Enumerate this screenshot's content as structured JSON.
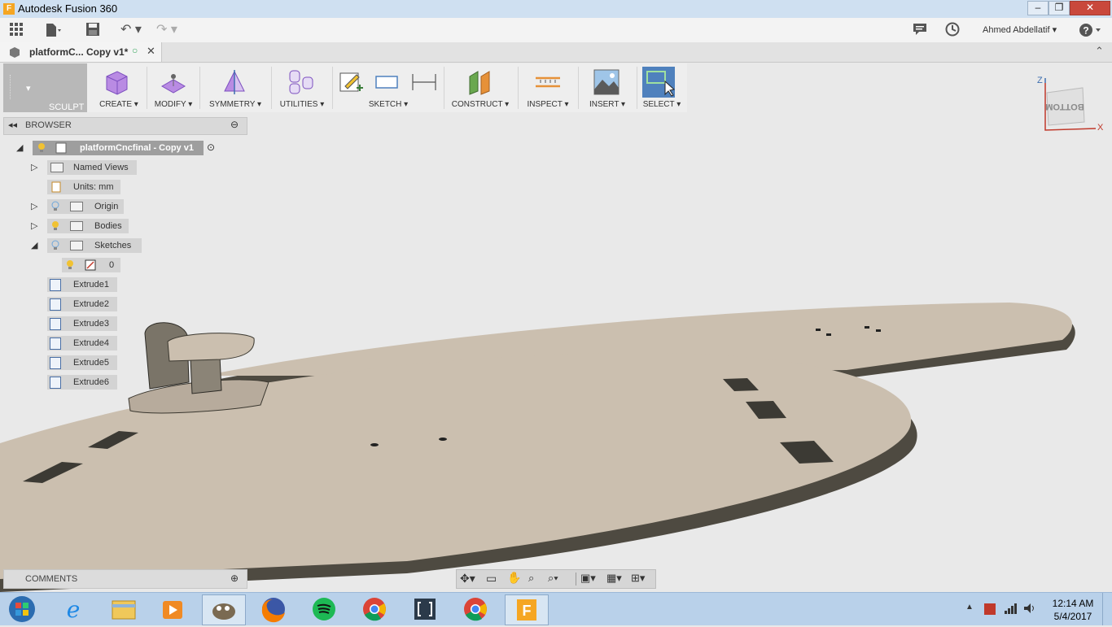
{
  "window": {
    "title": "Autodesk Fusion 360",
    "app_icon": "fusion-icon"
  },
  "quickbar": {
    "user_name": "Ahmed Abdellatif",
    "icons": [
      "grid-icon",
      "file-icon",
      "save-icon",
      "undo-icon",
      "redo-icon",
      "comment-icon",
      "history-icon",
      "help-icon"
    ]
  },
  "document_tab": {
    "name": "platformC... Copy v1*"
  },
  "ribbon": {
    "workspace": "SCULPT",
    "groups": [
      {
        "label": "CREATE",
        "icon": "create-box-icon"
      },
      {
        "label": "MODIFY",
        "icon": "modify-icon"
      },
      {
        "label": "SYMMETRY",
        "icon": "symmetry-icon"
      },
      {
        "label": "UTILITIES",
        "icon": "utilities-icon"
      },
      {
        "label": "SKETCH",
        "icon": "sketch-icon"
      },
      {
        "label": "CONSTRUCT",
        "icon": "construct-plane-icon"
      },
      {
        "label": "INSPECT",
        "icon": "measure-icon"
      },
      {
        "label": "INSERT",
        "icon": "insert-image-icon"
      },
      {
        "label": "SELECT",
        "icon": "select-icon"
      }
    ]
  },
  "browser": {
    "header": "BROWSER",
    "root": "platformCncfinal - Copy v1",
    "items": {
      "named_views": "Named Views",
      "units": "Units: mm",
      "origin": "Origin",
      "bodies": "Bodies",
      "sketches": "Sketches",
      "sketch0": "0",
      "extrudes": [
        "Extrude1",
        "Extrude2",
        "Extrude3",
        "Extrude4",
        "Extrude5",
        "Extrude6"
      ]
    }
  },
  "comments": {
    "label": "COMMENTS"
  },
  "viewcube": {
    "face": "BOTTOM",
    "axis_z": "Z",
    "axis_x": "X"
  },
  "taskbar": {
    "apps": [
      "windows-start-icon",
      "internet-explorer-icon",
      "file-explorer-icon",
      "media-player-icon",
      "gimp-icon",
      "firefox-icon",
      "spotify-icon",
      "chrome-icon",
      "brackets-icon",
      "chrome-icon",
      "fusion-360-icon"
    ],
    "time": "12:14 AM",
    "date": "5/4/2017"
  },
  "colors": {
    "model_face": "#cbbfaf",
    "model_edge": "#5a564c",
    "accent": "#4f81bd"
  }
}
